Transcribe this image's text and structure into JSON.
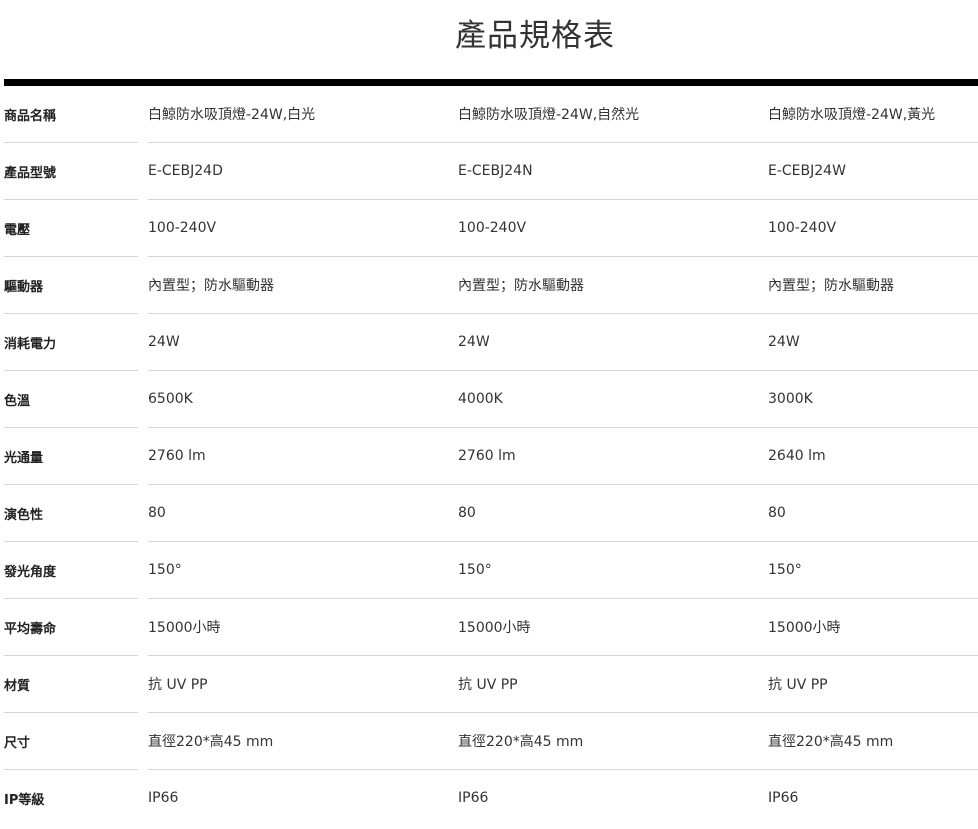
{
  "title": "產品規格表",
  "rows": [
    {
      "label": "商品名稱",
      "values": [
        "白鯨防水吸頂燈-24W,白光",
        "白鯨防水吸頂燈-24W,自然光",
        "白鯨防水吸頂燈-24W,黃光"
      ]
    },
    {
      "label": "產品型號",
      "values": [
        "E-CEBJ24D",
        "E-CEBJ24N",
        "E-CEBJ24W"
      ]
    },
    {
      "label": "電壓",
      "values": [
        "100-240V",
        "100-240V",
        "100-240V"
      ]
    },
    {
      "label": "驅動器",
      "values": [
        "內置型；防水驅動器",
        "內置型；防水驅動器",
        "內置型；防水驅動器"
      ]
    },
    {
      "label": "消耗電力",
      "values": [
        "24W",
        "24W",
        "24W"
      ]
    },
    {
      "label": "色溫",
      "values": [
        "6500K",
        "4000K",
        "3000K"
      ]
    },
    {
      "label": "光通量",
      "values": [
        "2760 lm",
        "2760 lm",
        "2640 lm"
      ]
    },
    {
      "label": "演色性",
      "values": [
        "80",
        "80",
        "80"
      ]
    },
    {
      "label": "發光角度",
      "values": [
        "150°",
        "150°",
        "150°"
      ]
    },
    {
      "label": "平均壽命",
      "values": [
        "15000小時",
        "15000小時",
        "15000小時"
      ]
    },
    {
      "label": "材質",
      "values": [
        "抗 UV PP",
        "抗 UV PP",
        "抗 UV PP"
      ]
    },
    {
      "label": "尺寸",
      "values": [
        "直徑220*高45 mm",
        "直徑220*高45 mm",
        "直徑220*高45 mm"
      ]
    },
    {
      "label": "IP等級",
      "values": [
        "IP66",
        "IP66",
        "IP66"
      ]
    }
  ]
}
